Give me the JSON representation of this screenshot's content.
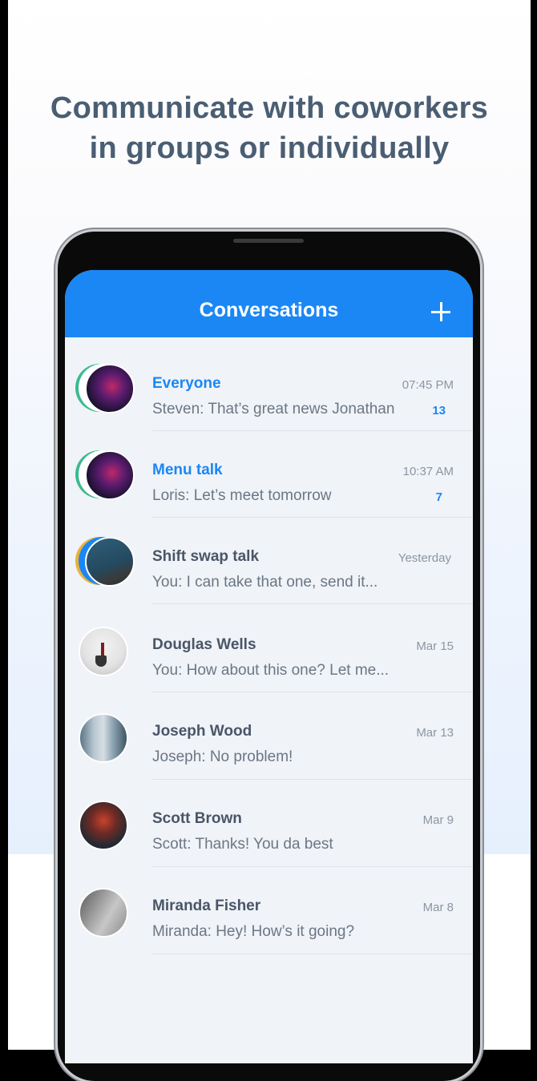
{
  "headline": {
    "line1": "Communicate with coworkers",
    "line2": "in groups or individually"
  },
  "app": {
    "title": "Conversations",
    "add_icon": "plus-icon",
    "accent_color": "#1a87f5"
  },
  "conversations": [
    {
      "name": "Everyone",
      "time": "07:45 PM",
      "preview": "Steven: That’s great news Jonathan",
      "badge": "13",
      "unread": true,
      "group": true
    },
    {
      "name": "Menu talk",
      "time": "10:37 AM",
      "preview": "Loris: Let’s meet tomorrow",
      "badge": "7",
      "unread": true,
      "group": true
    },
    {
      "name": "Shift swap talk",
      "time": "Yesterday",
      "preview": "You: I can take that one, send it...",
      "badge": "",
      "unread": false,
      "group": true
    },
    {
      "name": "Douglas Wells",
      "time": "Mar 15",
      "preview": "You: How about this one? Let me...",
      "badge": "",
      "unread": false,
      "group": false
    },
    {
      "name": "Joseph Wood",
      "time": "Mar 13",
      "preview": "Joseph: No problem!",
      "badge": "",
      "unread": false,
      "group": false
    },
    {
      "name": "Scott Brown",
      "time": "Mar 9",
      "preview": "Scott: Thanks! You da best",
      "badge": "",
      "unread": false,
      "group": false
    },
    {
      "name": "Miranda Fisher",
      "time": "Mar 8",
      "preview": "Miranda: Hey! How’s it going?",
      "badge": "",
      "unread": false,
      "group": false
    }
  ]
}
